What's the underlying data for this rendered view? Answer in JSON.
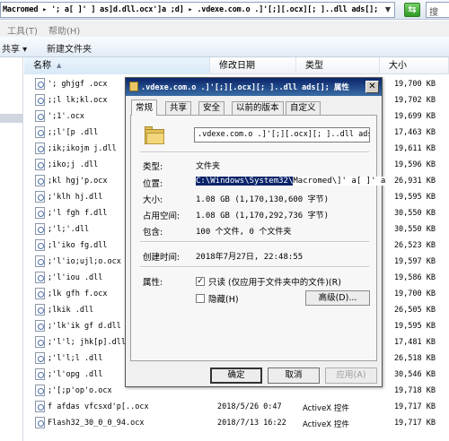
{
  "address_bar": {
    "path": "Macromed ▸ '; a[ ]' ] as]d.dll.ocx']a ;d] ▸ .vdexe.com.o .]'[;][.ocx][; ]..dll ads[];",
    "dropdown_icon": "chevron-down-icon",
    "refresh_icon": "refresh-arrows-icon",
    "search_icon": "search-icon",
    "search_glyph": "搜"
  },
  "menu": {
    "items": [
      "工具(T)",
      "帮助(H)"
    ]
  },
  "toolbar": {
    "share_label": "共享 ▾",
    "new_folder_label": "新建文件夹"
  },
  "columns": {
    "name": "名称",
    "modified": "修改日期",
    "type": "类型",
    "size": "大小"
  },
  "files": [
    {
      "name": "'; ghjgf .ocx",
      "date": "",
      "type": "",
      "size": "19,700 KB"
    },
    {
      "name": ";;l lk;kl.ocx",
      "date": "",
      "type": "",
      "size": "19,702 KB"
    },
    {
      "name": "';1'.ocx",
      "date": "",
      "type": "",
      "size": "19,699 KB"
    },
    {
      "name": ";;l'[p .dll",
      "date": "",
      "type": "",
      "size": "17,463 KB"
    },
    {
      "name": ";ik;ikojm j.dll",
      "date": "",
      "type": "",
      "size": "19,611 KB"
    },
    {
      "name": ";iko;j .dll",
      "date": "",
      "type": "",
      "size": "19,596 KB"
    },
    {
      "name": ";kl hgj'p.ocx",
      "date": "",
      "type": "",
      "size": "26,931 KB"
    },
    {
      "name": ";'klh hj.dll",
      "date": "",
      "type": "",
      "size": "19,595 KB"
    },
    {
      "name": ";'l fgh f.dll",
      "date": "",
      "type": "",
      "size": "30,550 KB"
    },
    {
      "name": ";'l;'.dll",
      "date": "",
      "type": "",
      "size": "30,550 KB"
    },
    {
      "name": ";l'iko fg.dll",
      "date": "",
      "type": "",
      "size": "26,523 KB"
    },
    {
      "name": ";'l'io;ujl;o.ocx",
      "date": "",
      "type": "",
      "size": "19,597 KB"
    },
    {
      "name": ";'l'iou .dll",
      "date": "",
      "type": "",
      "size": "19,586 KB"
    },
    {
      "name": ";lk gfh f.ocx",
      "date": "",
      "type": "",
      "size": "19,700 KB"
    },
    {
      "name": ";lkik .dll",
      "date": "",
      "type": "",
      "size": "26,505 KB"
    },
    {
      "name": ";'lk'ik gf d.dll",
      "date": "",
      "type": "",
      "size": "19,595 KB"
    },
    {
      "name": ";'l'l; jhk[p].dll",
      "date": "",
      "type": "",
      "size": "17,481 KB"
    },
    {
      "name": ";'l'l;l .dll",
      "date": "",
      "type": "",
      "size": "26,518 KB"
    },
    {
      "name": ";'l'opg .dll",
      "date": "",
      "type": "",
      "size": "30,546 KB"
    },
    {
      "name": ";'[;p'op'o.ocx",
      "date": "",
      "type": "",
      "size": "19,718 KB"
    },
    {
      "name": "f afdas vfcsxd'p[..ocx",
      "date": "2018/5/26 0:47",
      "type": "ActiveX 控件",
      "size": "19,717 KB"
    },
    {
      "name": "Flash32_30_0_0_94.ocx",
      "date": "2018/7/13 16:22",
      "type": "ActiveX 控件",
      "size": "19,717 KB"
    }
  ],
  "dialog": {
    "title": ".vdexe.com.o .]'[;][.ocx][; ]..dll ads[]; 属性",
    "close_label": "✕",
    "tabs": [
      "常规",
      "共享",
      "安全",
      "以前的版本",
      "自定义"
    ],
    "active_tab": 0,
    "folder_name": ".vdexe.com.o .]'[;][.ocx][; ]..dll ads[]",
    "type_label": "类型:",
    "type_value": "文件夹",
    "location_label": "位置:",
    "location_value_selected": "C:\\Windows\\System32\\",
    "location_value_rest": "Macromed\\]' a[ ]' a",
    "size_label": "大小:",
    "size_value": "1.08 GB (1,170,130,600 字节)",
    "disk_label": "占用空间:",
    "disk_value": "1.08 GB (1,170,292,736 字节)",
    "contains_label": "包含:",
    "contains_value": "100 个文件, 0 个文件夹",
    "created_label": "创建时间:",
    "created_value": "2018年7月27日, 22:48:55",
    "attrs_label": "属性:",
    "readonly_label": "只读 (仅应用于文件夹中的文件)(R)",
    "readonly_checked": true,
    "hidden_label": "隐藏(H)",
    "hidden_checked": false,
    "advanced_label": "高级(D)...",
    "ok_label": "确定",
    "cancel_label": "取消",
    "apply_label": "应用(A)"
  }
}
